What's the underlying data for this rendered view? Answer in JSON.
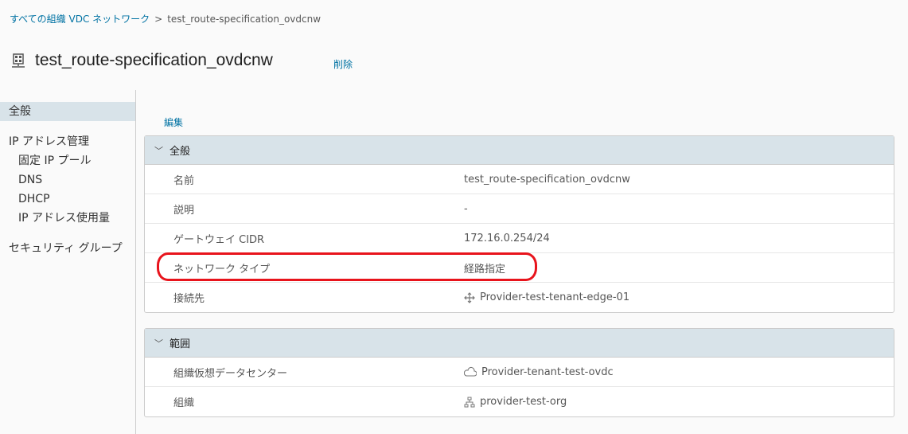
{
  "breadcrumb": {
    "parent": "すべての組織 VDC ネットワーク",
    "separator": ">",
    "current": "test_route-specification_ovdcnw"
  },
  "header": {
    "title": "test_route-specification_ovdcnw",
    "delete_label": "削除"
  },
  "sidebar": {
    "items": [
      {
        "label": "全般",
        "active": true
      },
      {
        "label": "IP アドレス管理"
      },
      {
        "label": "固定 IP プール",
        "sub": true
      },
      {
        "label": "DNS",
        "sub": true
      },
      {
        "label": "DHCP",
        "sub": true
      },
      {
        "label": "IP アドレス使用量",
        "sub": true
      },
      {
        "label": "セキュリティ グループ"
      }
    ]
  },
  "edit_label": "編集",
  "general": {
    "title": "全般",
    "rows": [
      {
        "key": "名前",
        "value": "test_route-specification_ovdcnw"
      },
      {
        "key": "説明",
        "value": "-"
      },
      {
        "key": "ゲートウェイ CIDR",
        "value": "172.16.0.254/24"
      },
      {
        "key": "ネットワーク タイプ",
        "value": "経路指定"
      },
      {
        "key": "接続先",
        "value": "Provider-test-tenant-edge-01",
        "icon": "edge-gateway-icon"
      }
    ]
  },
  "scope": {
    "title": "範囲",
    "rows": [
      {
        "key": "組織仮想データセンター",
        "value": "Provider-tenant-test-ovdc",
        "icon": "cloud-icon"
      },
      {
        "key": "組織",
        "value": "provider-test-org",
        "icon": "organization-icon"
      }
    ]
  },
  "colors": {
    "link": "#0072a3",
    "highlight": "#e8141c",
    "header_bg": "#d8e3e9"
  }
}
